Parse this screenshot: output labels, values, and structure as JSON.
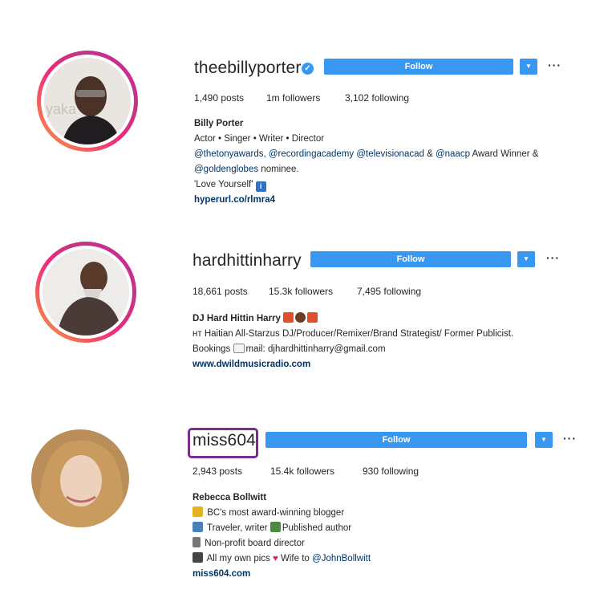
{
  "profiles": [
    {
      "username": "theebillyporter",
      "verified": true,
      "follow_label": "Follow",
      "more_label": "···",
      "stats": {
        "posts": "1,490 posts",
        "followers": "1m followers",
        "following": "3,102 following"
      },
      "bio": {
        "name": "Billy Porter",
        "line1": "Actor • Singer • Writer • Director",
        "line2_mentions": "@thetonyawards, @recordingacademy @televisionacad",
        "line2_amp": " & ",
        "line2_mention_b": "@naacp",
        "line2_tail": " Award Winner &",
        "line3_mention": "@goldenglobes",
        "line3_tail": " nominee.",
        "line4": "'Love Yourself'",
        "link": "hyperurl.co/rlmra4"
      }
    },
    {
      "username": "hardhittinharry",
      "follow_label": "Follow",
      "more_label": "···",
      "stats": {
        "posts": "18,661 posts",
        "followers": "15.3k followers",
        "following": "7,495 following"
      },
      "bio": {
        "name": "DJ Hard Hittin Harry",
        "line1": "ʜᴛ Haitian All-Starzus DJ/Producer/Remixer/Brand Strategist/ Former Publicist.",
        "line2_a": "Bookings ",
        "line2_b": "mail: djhardhittinharry@gmail.com",
        "link": "www.dwildmusicradio.com"
      }
    },
    {
      "username": "miss604",
      "follow_label": "Follow",
      "more_label": "···",
      "stats": {
        "posts": "2,943 posts",
        "followers": "15.4k followers",
        "following": "930 following"
      },
      "bio": {
        "name": "Rebecca Bollwitt",
        "line1": "BC's most award-winning blogger",
        "line2_a": "Traveler, writer ",
        "line2_b": "Published author",
        "line3": "Non-profit board director",
        "line4_a": "All my own pics ",
        "line4_b": " Wife to ",
        "line4_mention": "@JohnBollwitt",
        "link": "miss604.com"
      }
    }
  ],
  "colors": {
    "follow_blue": "#3897f0",
    "link_navy": "#003569",
    "highlight_purple": "#7b2d8e"
  },
  "icons": [
    "verified-badge-icon",
    "chevron-down-icon",
    "more-options-icon",
    "info-emoji-icon",
    "trophy-emoji-icon",
    "airplane-emoji-icon",
    "book-emoji-icon",
    "camera-emoji-icon",
    "heart-emoji-icon",
    "email-emoji-icon"
  ]
}
